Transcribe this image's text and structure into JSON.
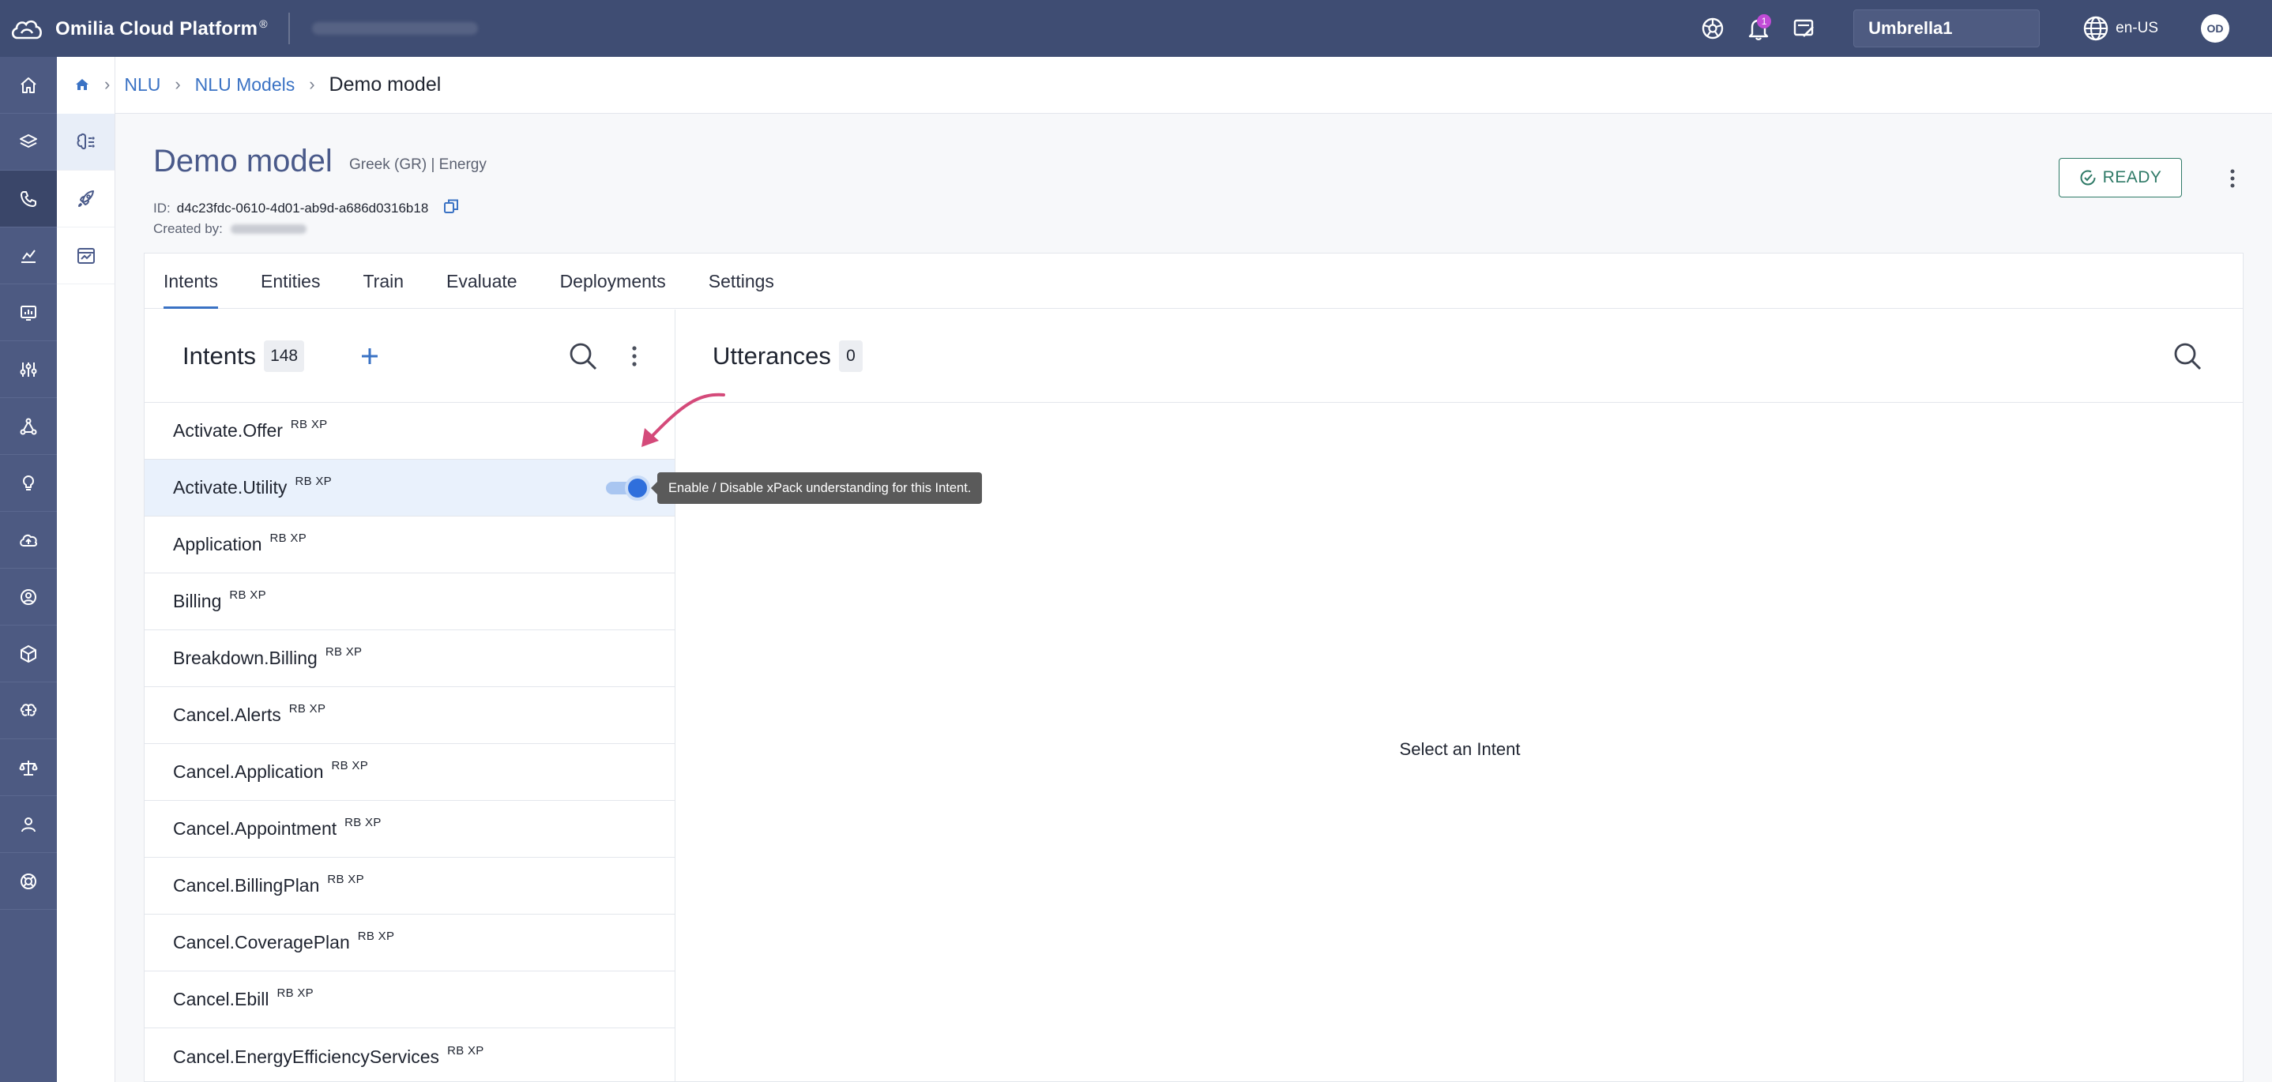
{
  "app": {
    "brand_name": "Omilia Cloud Platform",
    "brand_mark": "®"
  },
  "topbar": {
    "notification_count": "1",
    "tenant": "Umbrella1",
    "language": "en-US",
    "user_initials": "OD"
  },
  "breadcrumb": {
    "nlu": "NLU",
    "nlu_models": "NLU Models",
    "current": "Demo model"
  },
  "model": {
    "title": "Demo model",
    "meta": "Greek (GR) | Energy",
    "id_label": "ID:",
    "id_value": "d4c23fdc-0610-4d01-ab9d-a686d0316b18",
    "created_label": "Created by:",
    "status": "READY"
  },
  "tabs": [
    {
      "label": "Intents",
      "active": true
    },
    {
      "label": "Entities"
    },
    {
      "label": "Train"
    },
    {
      "label": "Evaluate"
    },
    {
      "label": "Deployments"
    },
    {
      "label": "Settings"
    }
  ],
  "intents_panel": {
    "title": "Intents",
    "count": "148",
    "items": [
      {
        "name": "Activate.Offer",
        "tag": "RB XP"
      },
      {
        "name": "Activate.Utility",
        "tag": "RB XP",
        "selected": true,
        "xpack_enabled": true
      },
      {
        "name": "Application",
        "tag": "RB XP"
      },
      {
        "name": "Billing",
        "tag": "RB XP"
      },
      {
        "name": "Breakdown.Billing",
        "tag": "RB XP"
      },
      {
        "name": "Cancel.Alerts",
        "tag": "RB XP"
      },
      {
        "name": "Cancel.Application",
        "tag": "RB XP"
      },
      {
        "name": "Cancel.Appointment",
        "tag": "RB XP"
      },
      {
        "name": "Cancel.BillingPlan",
        "tag": "RB XP"
      },
      {
        "name": "Cancel.CoveragePlan",
        "tag": "RB XP"
      },
      {
        "name": "Cancel.Ebill",
        "tag": "RB XP"
      },
      {
        "name": "Cancel.EnergyEfficiencyServices",
        "tag": "RB XP"
      }
    ]
  },
  "utterances_panel": {
    "title": "Utterances",
    "count": "0",
    "empty_message": "Select an Intent"
  },
  "tooltip": {
    "text": "Enable / Disable xPack understanding for this Intent."
  },
  "colors": {
    "topbar": "#3f4d73",
    "leftnav": "#4d5a82",
    "accent": "#3a72c4",
    "ready": "#2f7a67",
    "annotation_arrow": "#d44a7a"
  },
  "icons": {
    "leftnav": [
      "home-icon",
      "layers-icon",
      "phone-icon",
      "analytics-icon",
      "reports-icon",
      "sliders-icon",
      "network-icon",
      "bulb-icon",
      "cloud-icon",
      "agent-icon",
      "cube-icon",
      "brain-icon",
      "scale-icon",
      "user-icon",
      "support-icon"
    ],
    "subnav": [
      "nlu-icon",
      "rocket-icon",
      "evaluate-icon"
    ]
  }
}
